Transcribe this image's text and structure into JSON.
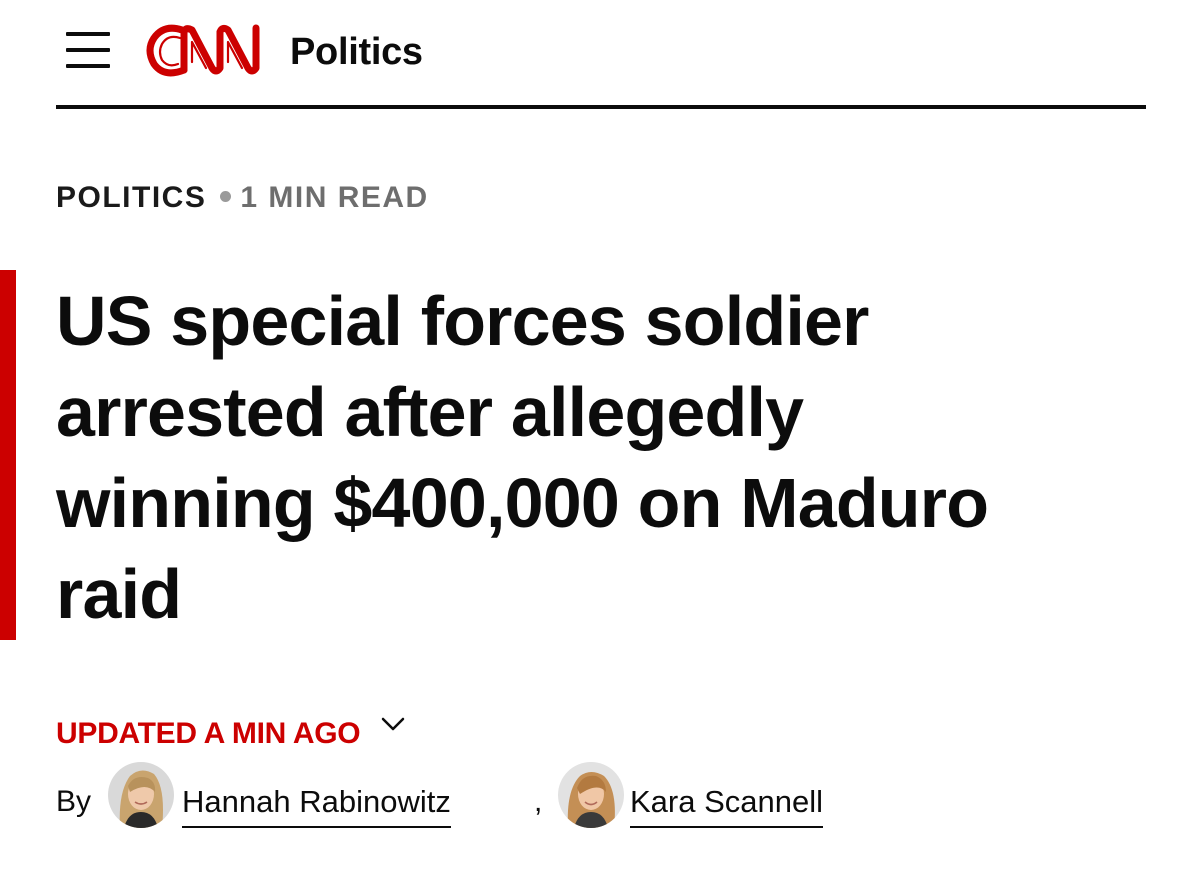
{
  "header": {
    "menu_icon": "hamburger-menu-icon",
    "logo_text": "CNN",
    "section": "Politics",
    "colors": {
      "brand": "#cc0000",
      "text": "#0c0c0c"
    }
  },
  "article": {
    "kicker": {
      "section": "POLITICS",
      "read_time": "1 MIN READ"
    },
    "headline": "US special forces soldier arrested after allegedly winning $400,000 on Maduro raid",
    "timestamp": "UPDATED A MIN AGO",
    "timestamp_icon": "chevron-down-icon",
    "byline": {
      "by": "By",
      "separator": ",",
      "authors": [
        {
          "name": "Hannah Rabinowitz",
          "avatar": "author-avatar"
        },
        {
          "name": "Kara Scannell",
          "avatar": "author-avatar"
        }
      ]
    }
  }
}
